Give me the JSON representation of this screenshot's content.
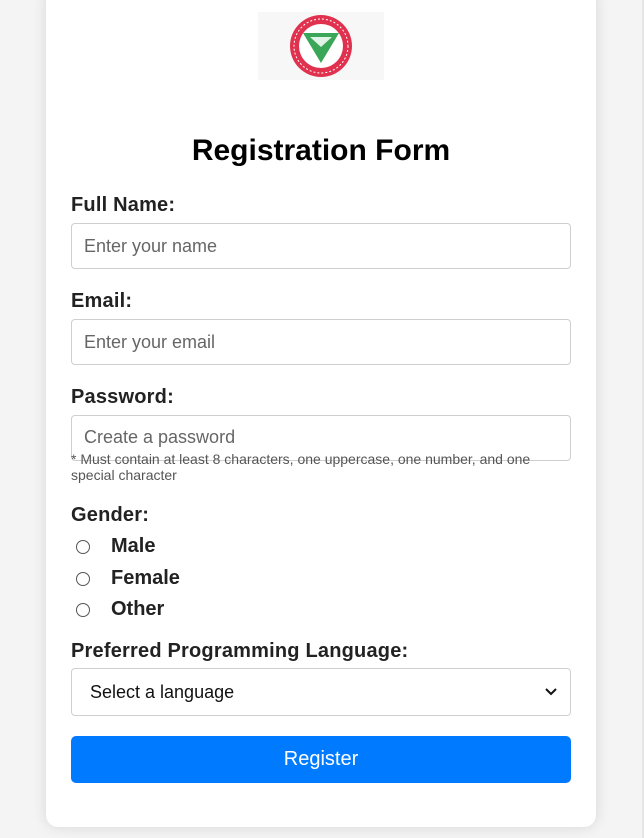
{
  "form": {
    "title": "Registration Form",
    "full_name": {
      "label": "Full Name:",
      "placeholder": "Enter your name"
    },
    "email": {
      "label": "Email:",
      "placeholder": "Enter your email"
    },
    "password": {
      "label": "Password:",
      "placeholder": "Create a password",
      "hint": "* Must contain at least 8 characters, one uppercase, one number, and one special character"
    },
    "gender": {
      "label": "Gender:",
      "options": [
        "Male",
        "Female",
        "Other"
      ]
    },
    "language": {
      "label": "Preferred Programming Language:",
      "selected": "Select a language"
    },
    "submit_label": "Register"
  },
  "colors": {
    "accent": "#007bff",
    "logo_red": "#e0324f",
    "logo_green": "#3aa657"
  }
}
